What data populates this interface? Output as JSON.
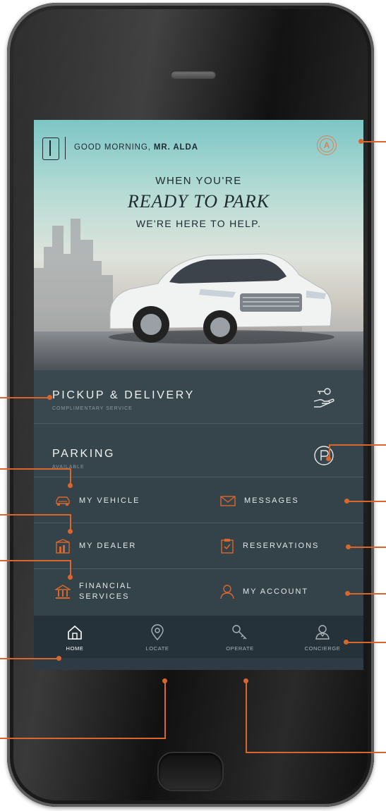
{
  "header": {
    "greeting_prefix": "GOOD MORNING, ",
    "greeting_name": "MR. ALDA",
    "avatar_initial": "A"
  },
  "hero": {
    "line1": "WHEN YOU'RE",
    "line2": "READY TO PARK",
    "line3": "WE'RE HERE TO HELP."
  },
  "services": {
    "pickup_title": "PICKUP & DELIVERY",
    "pickup_sub": "COMPLIMENTARY SERVICE",
    "parking_title": "PARKING",
    "parking_sub": "AVAILABLE"
  },
  "grid": {
    "my_vehicle": "MY VEHICLE",
    "messages": "MESSAGES",
    "my_dealer": "MY DEALER",
    "reservations": "RESERVATIONS",
    "financial_l1": "FINANCIAL",
    "financial_l2": "SERVICES",
    "my_account": "MY ACCOUNT"
  },
  "tabs": [
    "HOME",
    "LOCATE",
    "OPERATE",
    "CONCIERGE"
  ],
  "colors": {
    "accent": "#d9662d",
    "panel": "#2e3b44",
    "tabbar": "#26323a"
  }
}
